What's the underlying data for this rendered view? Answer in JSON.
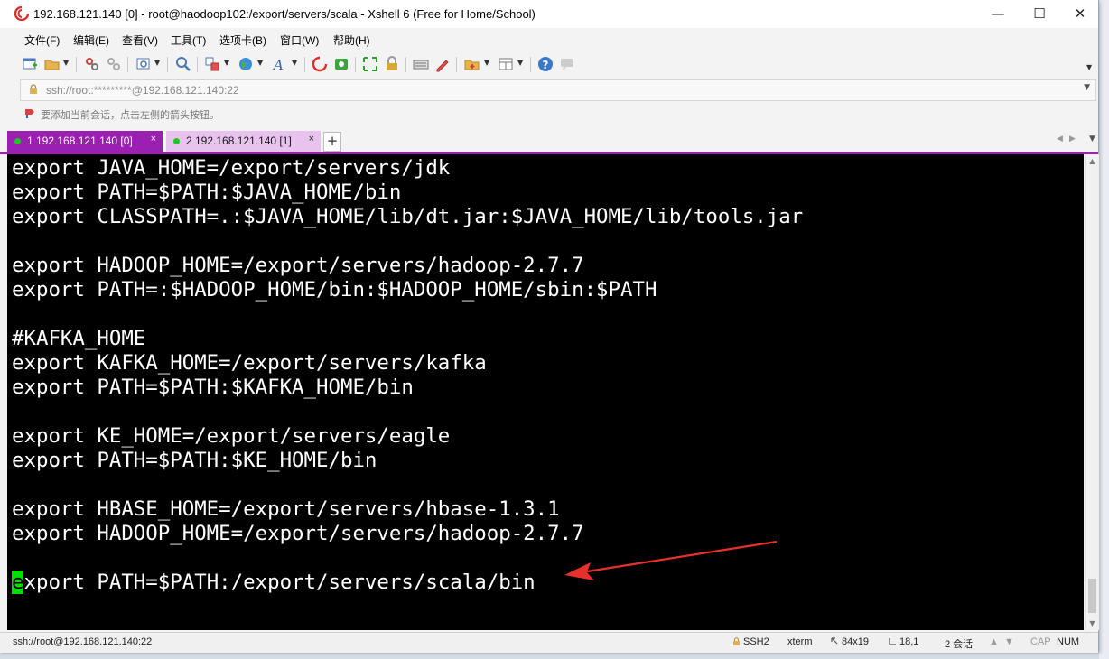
{
  "window": {
    "title": "192.168.121.140 [0] - root@haodoop102:/export/servers/scala - Xshell 6 (Free for Home/School)"
  },
  "menu": {
    "items": [
      "文件(F)",
      "编辑(E)",
      "查看(V)",
      "工具(T)",
      "选项卡(B)",
      "窗口(W)",
      "帮助(H)"
    ]
  },
  "toolbar": {
    "icons": [
      "new-session-icon",
      "open-folder-icon",
      "connect-icon",
      "disconnect-icon",
      "new-tab-icon",
      "find-icon",
      "transfer-icon",
      "globe-icon",
      "font-icon",
      "xshell-logo-icon",
      "xftp-icon",
      "fullscreen-icon",
      "lock-icon",
      "keyboard-icon",
      "script-icon",
      "add-folder-icon",
      "layout-icon",
      "help-icon",
      "chat-icon"
    ]
  },
  "address": {
    "value": "ssh://root:*********@192.168.121.140:22"
  },
  "hint": {
    "text": "要添加当前会话，点击左侧的箭头按钮。"
  },
  "tabs": [
    {
      "label": "1 192.168.121.140 [0]",
      "close": "×",
      "active": true
    },
    {
      "label": "2 192.168.121.140 [1]",
      "close": "×",
      "active": false
    }
  ],
  "tab_add": "+",
  "terminal": {
    "lines": [
      "export JAVA_HOME=/export/servers/jdk",
      "export PATH=$PATH:$JAVA_HOME/bin",
      "export CLASSPATH=.:$JAVA_HOME/lib/dt.jar:$JAVA_HOME/lib/tools.jar",
      "",
      "export HADOOP_HOME=/export/servers/hadoop-2.7.7",
      "export PATH=:$HADOOP_HOME/bin:$HADOOP_HOME/sbin:$PATH",
      "",
      "#KAFKA_HOME",
      "export KAFKA_HOME=/export/servers/kafka",
      "export PATH=$PATH:$KAFKA_HOME/bin",
      "",
      "export KE_HOME=/export/servers/eagle",
      "export PATH=$PATH:$KE_HOME/bin",
      "",
      "export HBASE_HOME=/export/servers/hbase-1.3.1",
      "export HADOOP_HOME=/export/servers/hadoop-2.7.7",
      ""
    ],
    "cursor_char": "e",
    "cursor_line_rest": "xport PATH=$PATH:/export/servers/scala/bin",
    "cursor_color": "#00e000",
    "arrow_color": "#e8302a"
  },
  "status": {
    "connection": "ssh://root@192.168.121.140:22",
    "protocol": "SSH2",
    "terminal_type": "xterm",
    "size": "84x19",
    "position": "18,1",
    "sessions": "2 会话",
    "caps": "CAP",
    "num": "NUM"
  }
}
